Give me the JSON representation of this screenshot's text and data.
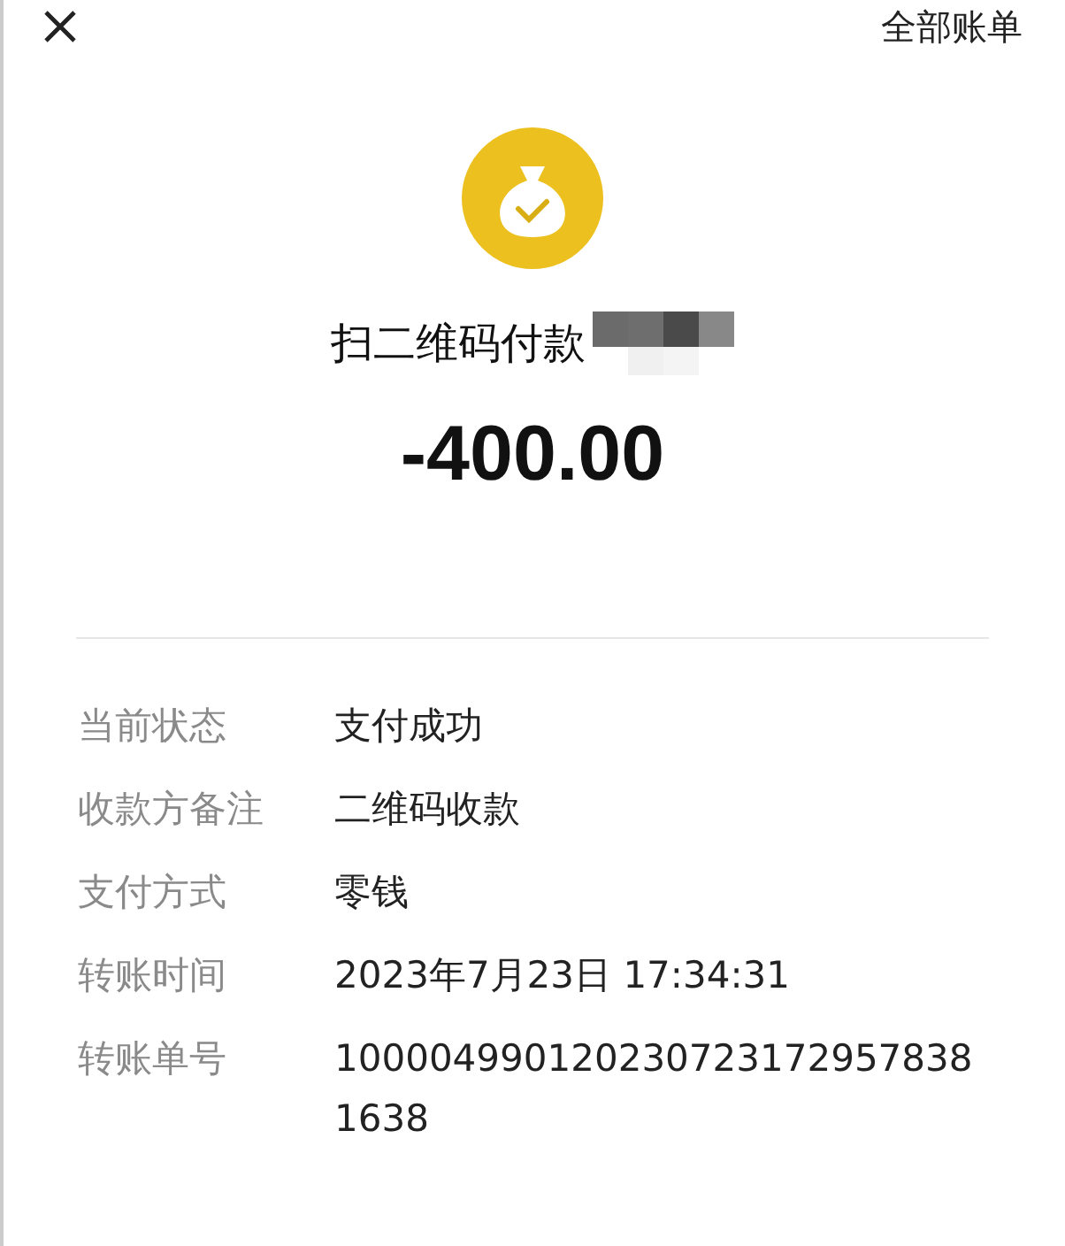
{
  "header": {
    "right_link": "全部账单"
  },
  "title": "扫二维码付款",
  "amount": "-400.00",
  "details": [
    {
      "label": "当前状态",
      "value": "支付成功"
    },
    {
      "label": "收款方备注",
      "value": "二维码收款"
    },
    {
      "label": "支付方式",
      "value": "零钱"
    },
    {
      "label": "转账时间",
      "value": "2023年7月23日 17:34:31"
    },
    {
      "label": "转账单号",
      "value": "1000049901202307231729578381638"
    }
  ]
}
